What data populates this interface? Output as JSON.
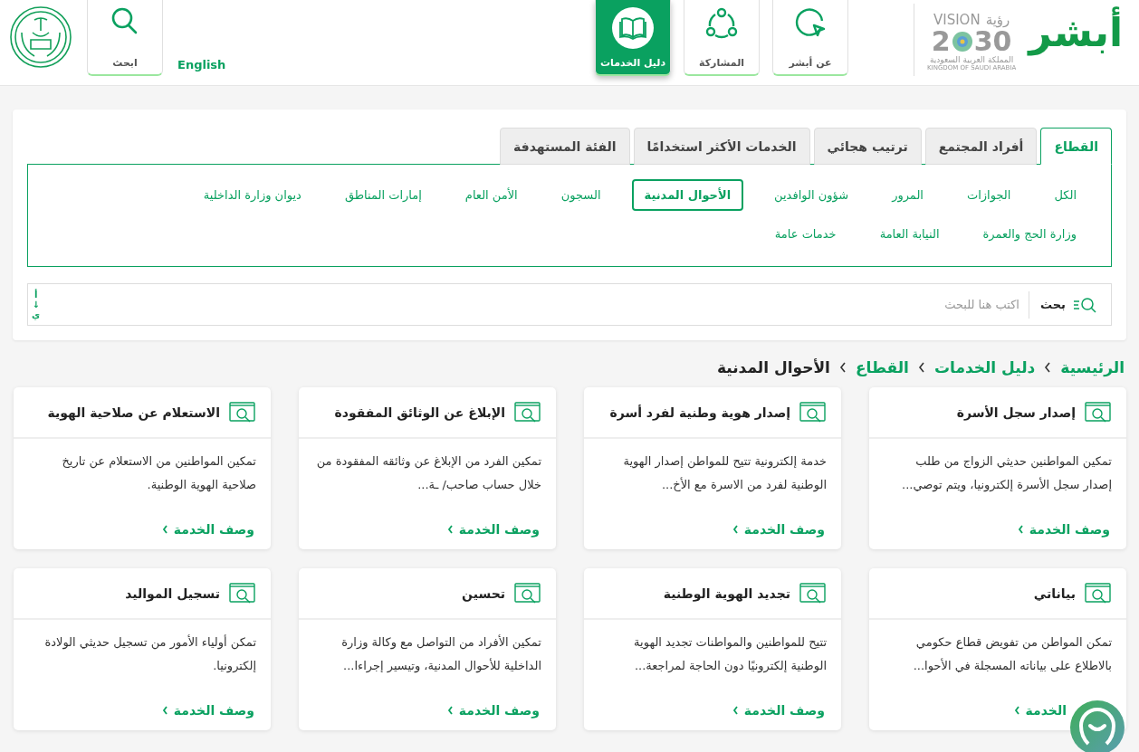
{
  "header": {
    "logo": {
      "text": "أبشر"
    },
    "vision_logo": {
      "word": "VISION",
      "arabic_word": "رؤية",
      "year_start": "2",
      "year_end": "30",
      "country_ar": "المملكة العربية السعودية",
      "country_en": "KINGDOM OF SAUDI ARABIA"
    },
    "nav": [
      {
        "label": "عن أبشر",
        "kind": "cursor",
        "selected": false
      },
      {
        "label": "المشاركة",
        "kind": "share",
        "selected": false
      },
      {
        "label": "دليل الخدمات",
        "kind": "book",
        "selected": true
      }
    ],
    "language_link": "English",
    "search_button": "ابحث"
  },
  "tabs": [
    {
      "label": "القطاع",
      "selected": true
    },
    {
      "label": "أفراد المجتمع",
      "selected": false
    },
    {
      "label": "ترتيب هجائي",
      "selected": false
    },
    {
      "label": "الخدمات الأكثر استخدامًا",
      "selected": false
    },
    {
      "label": "الفئة المستهدفة",
      "selected": false
    }
  ],
  "filters": [
    {
      "label": "الكل",
      "selected": false
    },
    {
      "label": "الجوازات",
      "selected": false
    },
    {
      "label": "المرور",
      "selected": false
    },
    {
      "label": "شؤون الوافدين",
      "selected": false
    },
    {
      "label": "الأحوال المدنية",
      "selected": true
    },
    {
      "label": "السجون",
      "selected": false
    },
    {
      "label": "الأمن العام",
      "selected": false
    },
    {
      "label": "إمارات المناطق",
      "selected": false
    },
    {
      "label": "ديوان وزارة الداخلية",
      "selected": false
    },
    {
      "label": "وزارة الحج والعمرة",
      "selected": false
    },
    {
      "label": "النيابة العامة",
      "selected": false
    },
    {
      "label": "خدمات عامة",
      "selected": false
    }
  ],
  "search": {
    "button": "بحث",
    "placeholder": "اكتب هنا للبحث",
    "sort_toggle": [
      "أ",
      "↓",
      "ي"
    ]
  },
  "breadcrumb": [
    "الرئيسية",
    "دليل الخدمات",
    "القطاع",
    "الأحوال المدنية"
  ],
  "cards": [
    {
      "title": "إصدار سجل الأسرة",
      "description": "تمكين المواطنين حديثي الزواج من طلب إصدار سجل الأسرة إلكترونيا، ويتم توصي...",
      "link": "وصف الخدمة"
    },
    {
      "title": "إصدار هوية وطنية لفرد أسرة",
      "description": "خدمة إلكترونية تتيح للمواطن إصدار الهوية الوطنية لفرد من الاسرة مع الأخ...",
      "link": "وصف الخدمة"
    },
    {
      "title": "الإبلاغ عن الوثائق المفقودة",
      "description": "تمكين الفرد من الإبلاغ عن وثائقه المفقودة من خلال حساب صاحب/ ـة...",
      "link": "وصف الخدمة"
    },
    {
      "title": "الاستعلام عن صلاحية الهوية",
      "description": "تمكين المواطنين من الاستعلام عن تاريخ صلاحية الهوية الوطنية.",
      "link": "وصف الخدمة"
    },
    {
      "title": "بياناتي",
      "description": "تمكن المواطن من تفويض قطاع حكومي بالاطلاع على بياناته المسجلة في الأحوا...",
      "link": "الخدمة",
      "chat_widget": true
    },
    {
      "title": "تجديد الهوية الوطنية",
      "description": "تتيح للمواطنين والمواطنات تجديد الهوية الوطنية إلكترونيًا دون الحاجة لمراجعة...",
      "link": "وصف الخدمة"
    },
    {
      "title": "تحسين",
      "description": "تمكين الأفراد من التواصل مع وكالة وزارة الداخلية للأحوال المدنية، وتيسير إجراءا...",
      "link": "وصف الخدمة"
    },
    {
      "title": "تسجيل المواليد",
      "description": "تمكن أولياء الأمور من تسجيل حديثي الولادة إلكترونيا.",
      "link": "وصف الخدمة"
    }
  ]
}
